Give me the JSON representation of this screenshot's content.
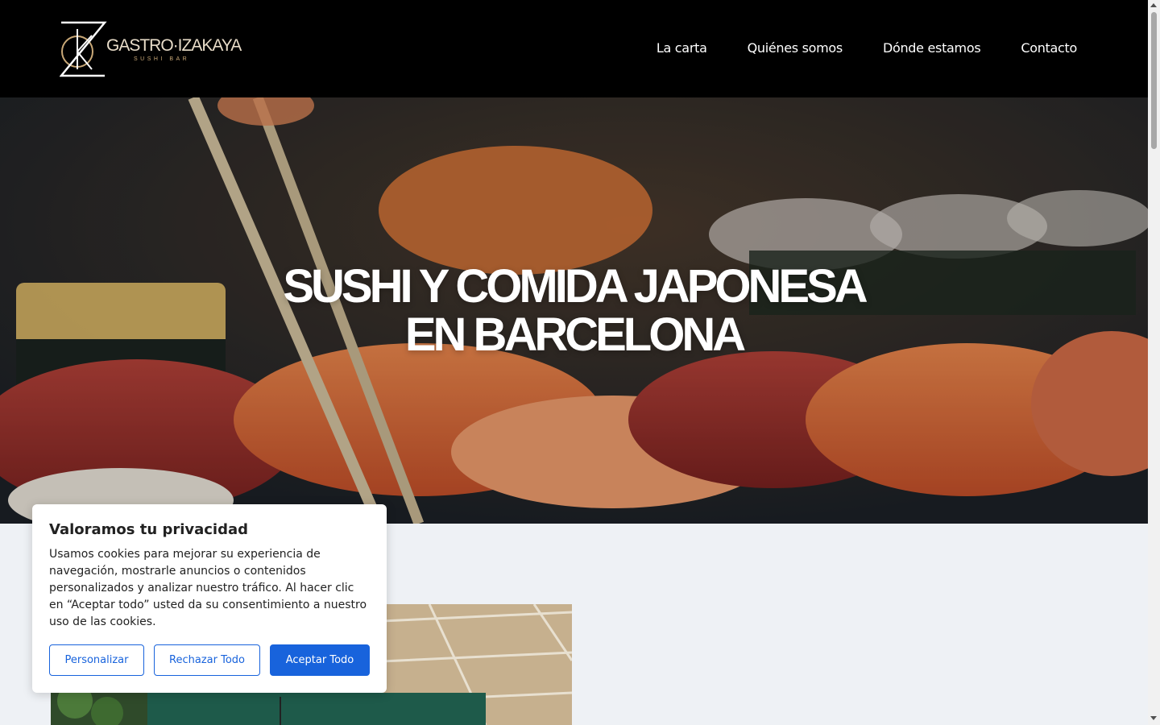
{
  "brand": {
    "name": "GASTRO·IZAKAYA",
    "tagline": "SUSHI BAR"
  },
  "nav": {
    "items": [
      {
        "label": "La carta"
      },
      {
        "label": "Quiénes somos"
      },
      {
        "label": "Dónde estamos"
      },
      {
        "label": "Contacto"
      }
    ]
  },
  "hero": {
    "title_line1": "SUSHI Y COMIDA JAPONESA",
    "title_line2": "EN BARCELONA",
    "image": "sushi-nigiri-chopsticks"
  },
  "section": {
    "image": "restaurant-interior-ceiling"
  },
  "cookie_banner": {
    "title": "Valoramos tu privacidad",
    "body": "Usamos cookies para mejorar su experiencia de navegación, mostrarle anuncios o contenidos personalizados y analizar nuestro tráfico. Al hacer clic en “Aceptar todo” usted da su consentimiento a nuestro uso de las cookies.",
    "customize_label": "Personalizar",
    "reject_label": "Rechazar Todo",
    "accept_label": "Aceptar Todo"
  },
  "colors": {
    "header_bg": "#000000",
    "logo_gold": "#c9a877",
    "accent_blue": "#1863dc"
  }
}
